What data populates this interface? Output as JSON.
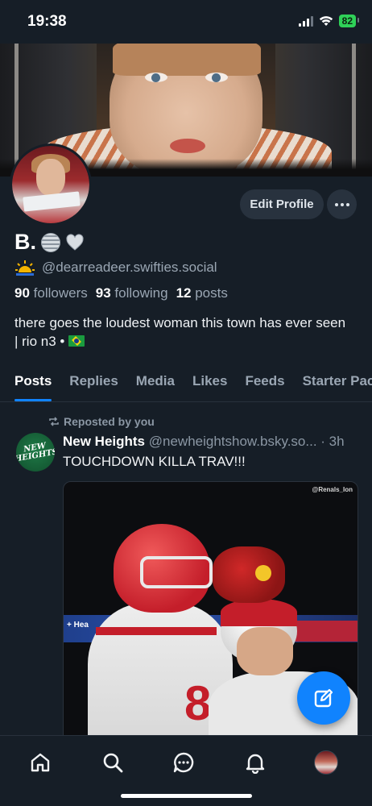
{
  "status_bar": {
    "time": "19:38",
    "battery": "82"
  },
  "profile": {
    "display_name": "B.",
    "handle": "@dearreadeer.swifties.social",
    "followers_count": "90",
    "followers_label": "followers",
    "following_count": "93",
    "following_label": "following",
    "posts_count": "12",
    "posts_label": "posts",
    "bio": "there goes the loudest woman this town has ever seen | rio n3 •",
    "edit_label": "Edit Profile"
  },
  "tabs": [
    "Posts",
    "Replies",
    "Media",
    "Likes",
    "Feeds",
    "Starter Pac"
  ],
  "post": {
    "repost_label": "Reposted by you",
    "author": "New Heights",
    "handle": "@newheightshow.bsky.so...",
    "time": "· 3h",
    "text": "TOUCHDOWN KILLA TRAV!!!",
    "avatar_text": "NEW HEIGHTS",
    "media_watermark": "@Renals_Ion",
    "media_banner_text": "+ Hea"
  },
  "nav": {
    "items": [
      "home-icon",
      "search-icon",
      "chat-icon",
      "bell-icon",
      "profile-avatar"
    ]
  },
  "colors": {
    "background": "#161e27",
    "accent": "#1083fe",
    "muted_text": "#9aa6b3",
    "button_bg": "#28323e"
  }
}
